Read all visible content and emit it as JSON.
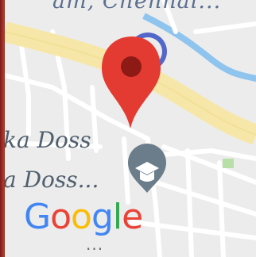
{
  "map": {
    "top_label": "am, Chennai...",
    "place_label_1": "ka Doss",
    "place_label_2": "a Doss...",
    "logo_text": "Google",
    "logo_letters": [
      {
        "ch": "G",
        "color": "#4285F4"
      },
      {
        "ch": "o",
        "color": "#EA4335"
      },
      {
        "ch": "o",
        "color": "#FBBC05"
      },
      {
        "ch": "g",
        "color": "#4285F4"
      },
      {
        "ch": "l",
        "color": "#34A853"
      },
      {
        "ch": "e",
        "color": "#EA4335"
      }
    ],
    "more_indicator": "...",
    "pin_icon": "location-pin-icon",
    "poi_icon": "graduation-cap-icon",
    "colors": {
      "pin": "#E33B32",
      "pin_center": "#8E1A15",
      "major_road": "#F6E7A8",
      "road": "#FFFFFF",
      "water": "#8FC4EE",
      "land": "#ECECEC",
      "poi_marker": "#6B7C8A"
    }
  }
}
